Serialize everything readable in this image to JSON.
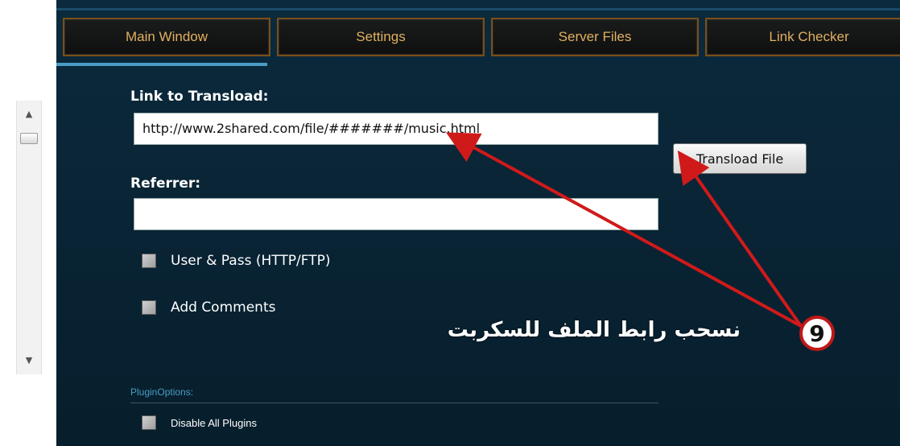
{
  "tabs": [
    {
      "label": "Main Window"
    },
    {
      "label": "Settings"
    },
    {
      "label": "Server Files"
    },
    {
      "label": "Link Checker"
    }
  ],
  "form": {
    "link_label": "Link to Transload:",
    "link_value": "http://www.2shared.com/file/#######/music.html",
    "referrer_label": "Referrer:",
    "referrer_value": "",
    "transload_button": "Transload File",
    "user_pass_label": "User & Pass (HTTP/FTP)",
    "add_comments_label": "Add Comments",
    "plugin_options_label": "PluginOptions:",
    "disable_plugins_label": "Disable All Plugins"
  },
  "annotation": {
    "number": "9",
    "text": "نسحب رابط الملف للسكربت"
  },
  "scrollbar": {
    "up_icon": "▲",
    "down_icon": "▼"
  },
  "colors": {
    "panel_bg": "#0b2a3d",
    "tab_text": "#e0b060",
    "tab_border": "#7a4e17",
    "accent": "#4a9cc4",
    "arrow": "#d01a1a"
  }
}
